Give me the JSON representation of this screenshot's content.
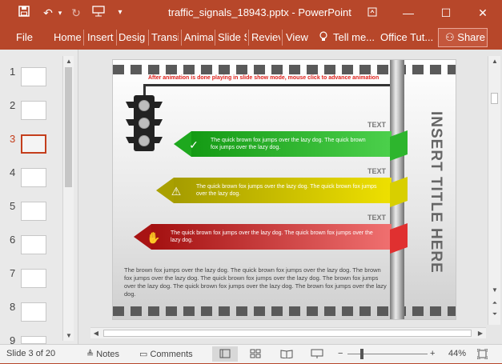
{
  "app": {
    "title": "traffic_signals_18943.pptx - PowerPoint",
    "quick_access": {
      "save_icon": "save-icon",
      "undo_icon": "undo-icon",
      "redo_icon": "redo-icon",
      "present_icon": "present-icon",
      "customize_icon": "chevron-down-icon"
    },
    "window_controls": {
      "ribbon_options": "ribbon-display-icon",
      "minimize": "minimize-icon",
      "restore": "restore-icon",
      "close": "close-icon"
    }
  },
  "ribbon": {
    "tabs": [
      "File",
      "Home",
      "Insert",
      "Design",
      "Transitions",
      "Animations",
      "Slide Show",
      "Review",
      "View"
    ],
    "tab_display": [
      "File",
      "Home",
      "Insert",
      "Desigr",
      "Transi",
      "Anima",
      "Slide S",
      "Reviev",
      "View"
    ],
    "tell_me": "Tell me...",
    "office_tut": "Office Tut...",
    "share": "Share"
  },
  "thumbnails": {
    "numbers": [
      "1",
      "2",
      "3",
      "4",
      "5",
      "6",
      "7",
      "8",
      "9"
    ],
    "active_index": 3
  },
  "slide": {
    "notice": "After animation is done playing in slide show mode, mouse click to advance animation",
    "title": "INSERT TITLE HERE",
    "items": [
      {
        "label": "TEXT",
        "text": "The quick brown fox jumps over the lazy dog. The quick brown fox jumps over the lazy dog.",
        "color": "#2db52d",
        "icon": "checkmark-icon"
      },
      {
        "label": "TEXT",
        "text": "The quick brown fox jumps over the lazy dog. The quick brown fox jumps over the lazy dog.",
        "color": "#c9bf00",
        "icon": "warning-icon"
      },
      {
        "label": "TEXT",
        "text": "The quick brown fox jumps over the lazy dog. The quick brown fox jumps over the lazy dog.",
        "color": "#c92020",
        "icon": "stop-hand-icon"
      }
    ],
    "paragraph": "The brown fox jumps over the lazy dog. The quick brown fox jumps over the lazy dog. The brown fox jumps over the lazy dog. The quick brown fox jumps over the lazy dog. The brown fox jumps over the lazy dog. The quick brown fox jumps over the lazy dog. The brown fox jumps over the lazy dog."
  },
  "status": {
    "slide_info": "Slide 3 of 20",
    "notes": "Notes",
    "comments": "Comments",
    "zoom_minus": "−",
    "zoom_plus": "+",
    "zoom": "44%"
  },
  "colors": {
    "accent": "#b7472a",
    "active": "#c43e1c"
  }
}
